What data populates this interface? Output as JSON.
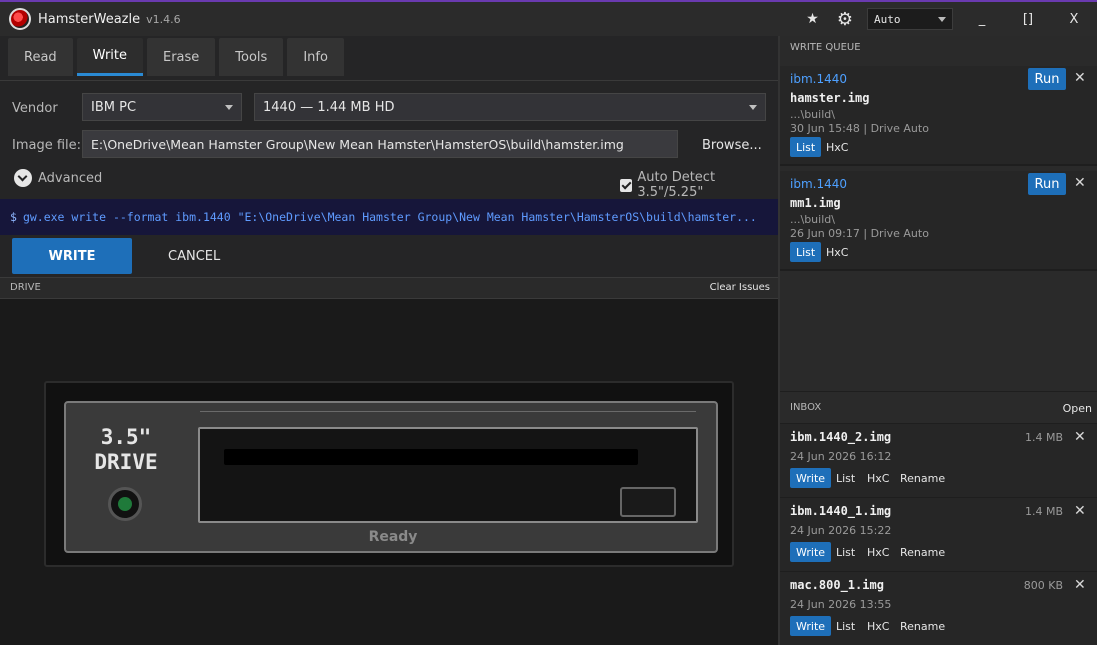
{
  "app": {
    "title": "HamsterWeazle",
    "version": "v1.4.6",
    "theme_select": "Auto",
    "accent": "#1e6fb9"
  },
  "window_controls": {
    "minimize": "_",
    "maximize": "[]",
    "close": "X"
  },
  "tabs": [
    {
      "label": "Read"
    },
    {
      "label": "Write"
    },
    {
      "label": "Erase"
    },
    {
      "label": "Tools"
    },
    {
      "label": "Info"
    }
  ],
  "active_tab": "Write",
  "form": {
    "vendor_label": "Vendor",
    "vendor_value": "IBM PC",
    "format_value": "1440  —  1.44 MB HD",
    "image_label": "Image file:",
    "image_value": "E:\\OneDrive\\Mean Hamster Group\\New Mean Hamster\\HamsterOS\\build\\hamster.img",
    "browse_label": "Browse...",
    "advanced_label": "Advanced",
    "autodetect_label": "Auto Detect 3.5\"/5.25\"",
    "autodetect_checked": true
  },
  "command": {
    "prompt": "$",
    "text": "gw.exe write --format ibm.1440 \"E:\\OneDrive\\Mean Hamster Group\\New Mean Hamster\\HamsterOS\\build\\hamster..."
  },
  "actions": {
    "write_label": "WRITE",
    "cancel_label": "CANCEL"
  },
  "drive": {
    "section_title": "DRIVE",
    "clear_label": "Clear Issues",
    "size_label": "3.5\"",
    "drive_label": "DRIVE",
    "status": "Ready"
  },
  "write_queue": {
    "title": "WRITE QUEUE",
    "items": [
      {
        "format": "ibm.1440",
        "name": "hamster.img",
        "path": "...\\build\\",
        "meta": "30 Jun 15:48  |  Drive Auto",
        "run_label": "Run",
        "list_label": "List",
        "hxc_label": "HxC"
      },
      {
        "format": "ibm.1440",
        "name": "mm1.img",
        "path": "...\\build\\",
        "meta": "26 Jun 09:17  |  Drive Auto",
        "run_label": "Run",
        "list_label": "List",
        "hxc_label": "HxC"
      }
    ]
  },
  "inbox": {
    "title": "INBOX",
    "open_label": "Open",
    "items": [
      {
        "name": "ibm.1440_2.img",
        "size": "1.4 MB",
        "date": "24 Jun 2026  16:12",
        "write_label": "Write",
        "list_label": "List",
        "hxc_label": "HxC",
        "rename_label": "Rename"
      },
      {
        "name": "ibm.1440_1.img",
        "size": "1.4 MB",
        "date": "24 Jun 2026  15:22",
        "write_label": "Write",
        "list_label": "List",
        "hxc_label": "HxC",
        "rename_label": "Rename"
      },
      {
        "name": "mac.800_1.img",
        "size": "800 KB",
        "date": "24 Jun 2026  13:55",
        "write_label": "Write",
        "list_label": "List",
        "hxc_label": "HxC",
        "rename_label": "Rename"
      }
    ]
  }
}
